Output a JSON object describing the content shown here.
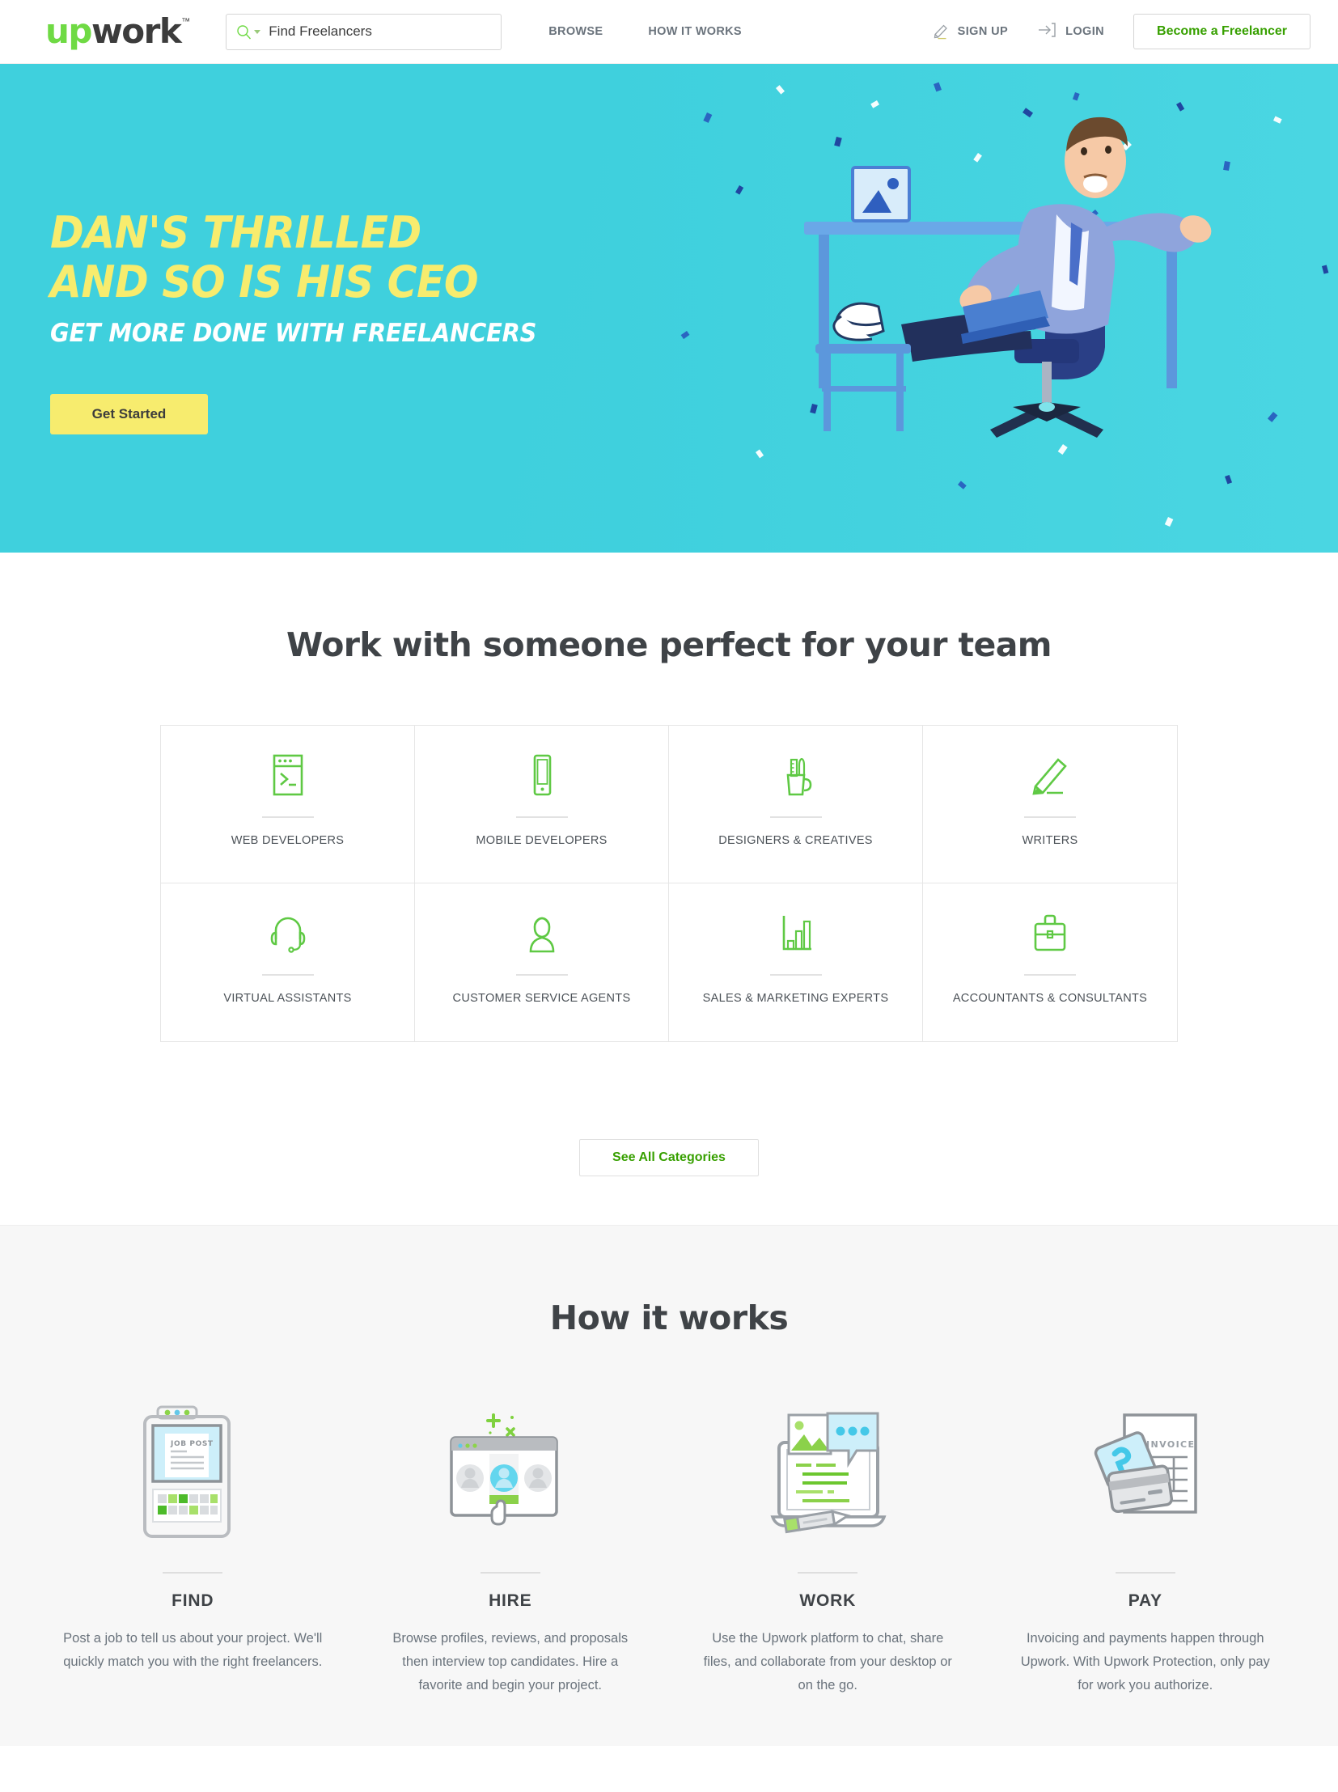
{
  "brand": {
    "logo_up": "up",
    "logo_work": "work",
    "logo_tm": "™",
    "green": "#6fda44",
    "green_link": "#37a000",
    "hero_cyan": "#3fd0dd",
    "hero_yellow": "#f7ec6e",
    "text_dark": "#3f4347",
    "text_muted": "#6a737c"
  },
  "header": {
    "search": {
      "placeholder": "Find Freelancers",
      "value": "Find Freelancers",
      "icon": "search-icon",
      "caret_icon": "chevron-down-icon"
    },
    "nav": [
      {
        "label": "BROWSE",
        "name": "browse"
      },
      {
        "label": "HOW IT WORKS",
        "name": "how-it-works"
      }
    ],
    "actions": [
      {
        "label": "SIGN UP",
        "icon": "pencil-icon",
        "name": "sign-up"
      },
      {
        "label": "LOGIN",
        "icon": "login-arrow-icon",
        "name": "login"
      }
    ],
    "cta": {
      "label": "Become a Freelancer"
    }
  },
  "hero": {
    "headline_line1": "DAN'S THRILLED",
    "headline_line2": "AND SO IS HIS CEO",
    "subheadline": "GET MORE DONE WITH FREELANCERS",
    "cta_label": "Get Started",
    "art_alt": "man-celebrating-at-desk-illustration"
  },
  "categories": {
    "title": "Work with someone perfect for your team",
    "items": [
      {
        "label": "WEB DEVELOPERS",
        "icon": "terminal-window-icon"
      },
      {
        "label": "MOBILE DEVELOPERS",
        "icon": "mobile-phone-icon"
      },
      {
        "label": "DESIGNERS & CREATIVES",
        "icon": "pencil-cup-icon"
      },
      {
        "label": "WRITERS",
        "icon": "pencil-icon"
      },
      {
        "label": "VIRTUAL ASSISTANTS",
        "icon": "headset-icon"
      },
      {
        "label": "CUSTOMER SERVICE AGENTS",
        "icon": "person-icon"
      },
      {
        "label": "SALES & MARKETING EXPERTS",
        "icon": "bar-chart-icon"
      },
      {
        "label": "ACCOUNTANTS & CONSULTANTS",
        "icon": "briefcase-icon"
      }
    ],
    "see_all_label": "See All Categories"
  },
  "how_it_works": {
    "title": "How it works",
    "steps": [
      {
        "step": "FIND",
        "desc": "Post a job to tell us about your project. We'll quickly match you with the right freelancers.",
        "art": "job-post-clipboard-illustration",
        "art_text": "JOB POST"
      },
      {
        "step": "HIRE",
        "desc": "Browse profiles, reviews, and proposals then interview top candidates. Hire a favorite and begin your project.",
        "art": "browser-profiles-illustration"
      },
      {
        "step": "WORK",
        "desc": "Use the Upwork platform to chat, share files, and collaborate from your desktop or on the go.",
        "art": "laptop-chat-illustration"
      },
      {
        "step": "PAY",
        "desc": "Invoicing and payments happen through Upwork. With Upwork Protection, only pay for work you authorize.",
        "art": "invoice-credit-card-illustration",
        "art_text": "INVOICE"
      }
    ]
  }
}
